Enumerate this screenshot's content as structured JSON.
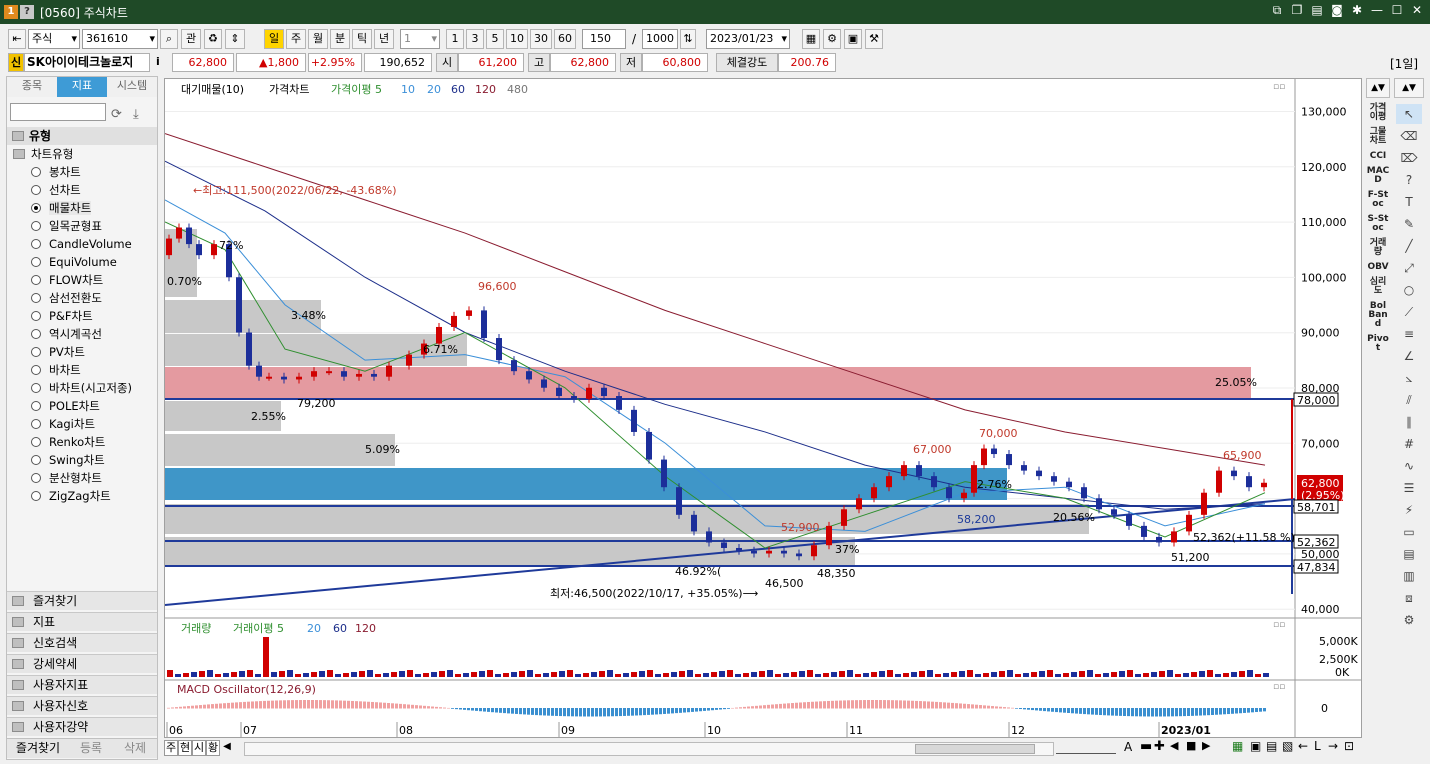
{
  "window": {
    "title": "[0560] 주식차트",
    "badge1": "1",
    "badge2": "?"
  },
  "toolbar": {
    "market": "주식",
    "code": "361610",
    "btn_gwan": "관",
    "periods": [
      "일",
      "주",
      "월",
      "분",
      "틱",
      "년"
    ],
    "interval_value": "1",
    "quick_intervals": [
      "1",
      "3",
      "5",
      "10",
      "30",
      "60"
    ],
    "count": "150",
    "slash": "/",
    "total": "1000",
    "date": "2023/01/23"
  },
  "info": {
    "company_tag": "신",
    "company": "SK아이이테크놀로지",
    "info_icon": "i",
    "price": "62,800",
    "change": "▲1,800",
    "pct": "+2.95%",
    "volume": "190,652",
    "open_label": "시",
    "open": "61,200",
    "high_label": "고",
    "high": "62,800",
    "low_label": "저",
    "low": "60,800",
    "strength_label": "체결강도",
    "strength": "200.76",
    "period_badge": "[1일]"
  },
  "leftpanel": {
    "tabs": [
      "종목",
      "지표",
      "시스템"
    ],
    "section": "유형",
    "group": "차트유형",
    "types": [
      "봉차트",
      "선차트",
      "매물차트",
      "일목균형표",
      "CandleVolume",
      "EquiVolume",
      "FLOW차트",
      "삼선전환도",
      "P&F차트",
      "역시계곡선",
      "PV차트",
      "바차트",
      "바차트(시고저종)",
      "POLE차트",
      "Kagi차트",
      "Renko차트",
      "Swing차트",
      "분산형차트",
      "ZigZag차트"
    ],
    "selected_type": 2,
    "bottom_folders": [
      "즐겨찾기",
      "지표",
      "신호검색",
      "강세약세",
      "사용자지표",
      "사용자신호",
      "사용자강약"
    ],
    "footer": [
      "즐겨찾기",
      "등록",
      "삭제"
    ]
  },
  "chart": {
    "legend": {
      "l1": "대기매물(10)",
      "l2": "가격차트",
      "l3": "가격이평 5",
      "l4": "10",
      "l5": "20",
      "l6": "60",
      "l7": "120",
      "l8": "480"
    },
    "y_ticks": [
      "130,000",
      "120,000",
      "110,000",
      "100,000",
      "90,000",
      "80,000",
      "70,000",
      "60,000",
      "50,000",
      "40,000"
    ],
    "x_ticks": [
      "06",
      "07",
      "08",
      "09",
      "10",
      "11",
      "12",
      "2023/01"
    ],
    "annotations": {
      "max_note": "←최고:111,500(2022/06/22, -43.68%)",
      "min_note": "최저:46,500(2022/10/17, +35.05%)⟶",
      "p96600": "96,600",
      "p79200": "79,200",
      "p52900": "52,900",
      "p46500": "46,500",
      "p48350": "48,350",
      "p67000": "67,000",
      "p70000": "70,000",
      "p58200": "58,200",
      "p65900": "65,900",
      "p51200": "51,200",
      "p52362": "52,362(+11.58 %)",
      "pct_070": "0.70%",
      "pct_348": "3.48%",
      "pct_255": "2.55%",
      "pct_509": "5.09%",
      "pct_2505": "25.05%",
      "pct_671": "6.71%",
      "pct_2056": "20.56%",
      "pct_72": "72%",
      "pct_276": "2.76%",
      "pct_4692": "46.92%(",
      "pct_37": "37%",
      "tag_price": "62,800",
      "tag_pct": "(2.95%)",
      "tag_78000": "78,000",
      "tag_58701": "58,701",
      "tag_52362": "52,362",
      "tag_47834": "47,834"
    },
    "volume_legend": {
      "l1": "거래량",
      "l2": "거래이평 5",
      "l3": "20",
      "l4": "60",
      "l5": "120"
    },
    "volume_ticks": [
      "5,000K",
      "2,500K",
      "0K"
    ],
    "macd_legend": "MACD Oscillator(12,26,9)",
    "macd_zero": "0"
  },
  "rightbar": [
    "가격이평",
    "그물차트",
    "CCI",
    "MACD",
    "F-Stoc",
    "S-Stoc",
    "거래량",
    "OBV",
    "심리도",
    "Bol Band",
    "Pivot"
  ],
  "bottom": {
    "tabs": [
      "주",
      "현",
      "시",
      "황"
    ],
    "zoom_label": "A"
  }
}
